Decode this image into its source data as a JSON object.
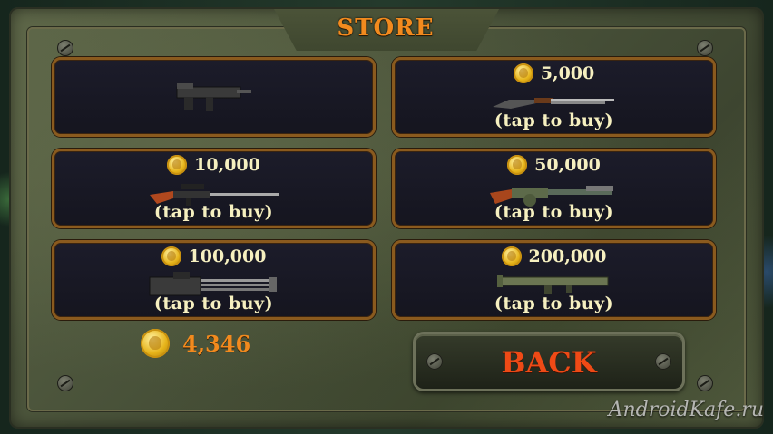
{
  "title": "STORE",
  "items": [
    {
      "price": "",
      "tap_label": "",
      "weapon": "smg"
    },
    {
      "price": "5,000",
      "tap_label": "(tap to buy)",
      "weapon": "shotgun"
    },
    {
      "price": "10,000",
      "tap_label": "(tap to buy)",
      "weapon": "sniper-rifle"
    },
    {
      "price": "50,000",
      "tap_label": "(tap to buy)",
      "weapon": "grenade-launcher-rifle"
    },
    {
      "price": "100,000",
      "tap_label": "(tap to buy)",
      "weapon": "minigun"
    },
    {
      "price": "200,000",
      "tap_label": "(tap to buy)",
      "weapon": "rocket-launcher"
    }
  ],
  "balance": "4,346",
  "back_label": "BACK",
  "watermark": "AndroidKafe.ru",
  "colors": {
    "title": "#f28a1e",
    "panel_border": "#8a5a1e",
    "text": "#f6f0c0",
    "back": "#ef4a16"
  }
}
